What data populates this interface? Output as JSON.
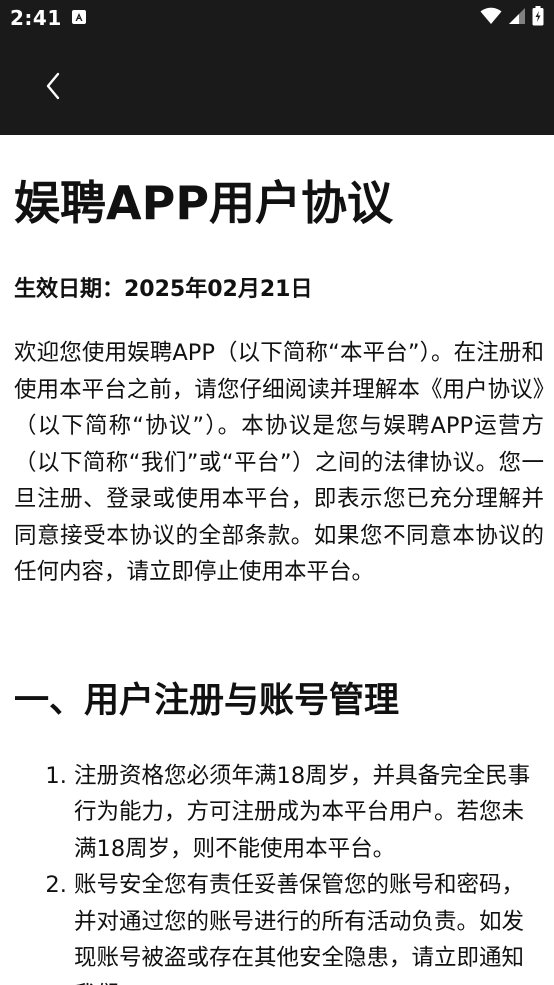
{
  "status_bar": {
    "time": "2:41"
  },
  "app_bar": {
    "back_icon": "chevron-left-icon"
  },
  "document": {
    "title": "娱聘APP用户协议",
    "effective_date": "生效日期：2025年02月21日",
    "intro": "欢迎您使用娱聘APP（以下简称“本平台”）。在注册和使用本平台之前，请您仔细阅读并理解本《用户协议》（以下简称“协议”）。本协议是您与娱聘APP运营方（以下简称“我们”或“平台”）之间的法律协议。您一旦注册、登录或使用本平台，即表示您已充分理解并同意接受本协议的全部条款。如果您不同意本协议的任何内容，请立即停止使用本平台。",
    "section_1": {
      "title": "一、用户注册与账号管理",
      "items": [
        "注册资格您必须年满18周岁，并具备完全民事行为能力，方可注册成为本平台用户。若您未满18周岁，则不能使用本平台。",
        "账号安全您有责任妥善保管您的账号和密码，并对通过您的账号进行的所有活动负责。如发现账号被盗或存在其他安全隐患，请立即通知我们。"
      ]
    }
  },
  "colors": {
    "bar_background": "#1a1a1a",
    "page_background": "#ffffff",
    "text": "#111111"
  }
}
